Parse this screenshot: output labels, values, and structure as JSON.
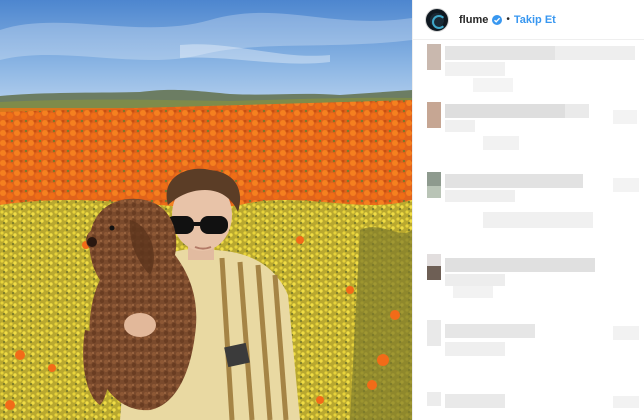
{
  "header": {
    "username": "flume",
    "separator": "•",
    "follow_label": "Takip Et"
  },
  "icons": {
    "avatar": "profile-avatar",
    "verified": "verified-badge-icon"
  },
  "colors": {
    "accent": "#3897f0",
    "text": "#262626",
    "divider": "#efefef"
  }
}
